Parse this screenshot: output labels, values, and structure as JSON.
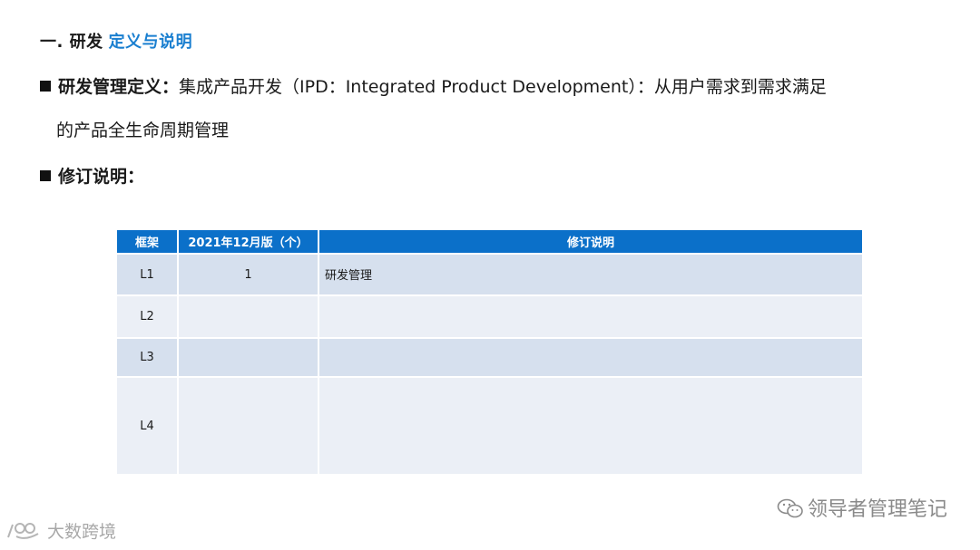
{
  "heading": {
    "prefix": "一. 研发",
    "accent": "定义与说明"
  },
  "definition": {
    "label": "研发管理定义：",
    "text_line1": "集成产品开发（IPD：Integrated Product Development）：从用户需求到需求满足",
    "text_line2": "的产品全生命周期管理"
  },
  "revision": {
    "label": "修订说明："
  },
  "table": {
    "headers": [
      "框架",
      "2021年12月版（个）",
      "修订说明"
    ],
    "rows": [
      {
        "framework": "L1",
        "count": "1",
        "note": "研发管理"
      },
      {
        "framework": "L2",
        "count": "",
        "note": ""
      },
      {
        "framework": "L3",
        "count": "",
        "note": ""
      },
      {
        "framework": "L4",
        "count": "",
        "note": ""
      }
    ]
  },
  "watermarks": {
    "right": "领导者管理笔记",
    "left": "大数跨境"
  },
  "colors": {
    "accent": "#1a7fd0",
    "table_header": "#0b70c9",
    "row_dark": "#d6e0ee",
    "row_light": "#ebeff6"
  }
}
